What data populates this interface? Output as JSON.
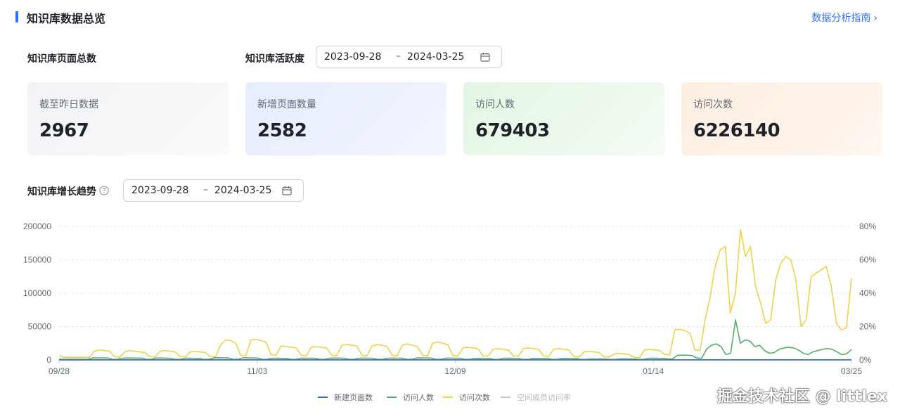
{
  "header": {
    "title": "知识库数据总览",
    "guide_link": "数据分析指南"
  },
  "overview": {
    "total_pages_label": "知识库页面总数",
    "activity_label": "知识库活跃度",
    "activity_range": {
      "start": "2023-09-28",
      "sep": "–",
      "end": "2024-03-25"
    }
  },
  "cards": [
    {
      "label": "截至昨日数据",
      "value": "2967"
    },
    {
      "label": "新增页面数量",
      "value": "2582"
    },
    {
      "label": "访问人数",
      "value": "679403"
    },
    {
      "label": "访问次数",
      "value": "6226140"
    }
  ],
  "trend": {
    "label": "知识库增长趋势",
    "range": {
      "start": "2023-09-28",
      "sep": "–",
      "end": "2024-03-25"
    }
  },
  "colors": {
    "accent": "#3370ff",
    "new_pages": "#3f6fd0",
    "visitors": "#5aaa6a",
    "visits": "#efd24a",
    "member_rate": "#c8cacd"
  },
  "watermark": "掘金技术社区 @ littlex",
  "chart_data": {
    "type": "line",
    "x_ticks": [
      "09/28",
      "11/03",
      "12/09",
      "01/14",
      "03/25"
    ],
    "y_left": {
      "ticks": [
        "0",
        "50000",
        "100000",
        "150000",
        "200000"
      ],
      "range": [
        0,
        200000
      ]
    },
    "y_right": {
      "ticks": [
        "0%",
        "20%",
        "40%",
        "60%",
        "80%"
      ],
      "range": [
        0,
        80
      ]
    },
    "grid": true,
    "legend_position": "bottom",
    "series": [
      {
        "name": "新建页面数",
        "axis": "left",
        "color": "#3f6fd0",
        "values": [
          200,
          150,
          150,
          150,
          150,
          150,
          180,
          200,
          200,
          200,
          200,
          220,
          200,
          200,
          180,
          200,
          200,
          220,
          200,
          180,
          200,
          180,
          200,
          200,
          200,
          180,
          200,
          200,
          200,
          200,
          180,
          200,
          220,
          200,
          200,
          200,
          200,
          200,
          200,
          200,
          200,
          200,
          200,
          200,
          200,
          200,
          200,
          200,
          200,
          200,
          200,
          200,
          200,
          200,
          200,
          200,
          200,
          200,
          200,
          200,
          200,
          200,
          200,
          200,
          200,
          200,
          200,
          200,
          200,
          200,
          200,
          200,
          200,
          200,
          200,
          200,
          200,
          200,
          200,
          200,
          200,
          200,
          200,
          200,
          200,
          200,
          200,
          200,
          200,
          200,
          200,
          200,
          200,
          200,
          200,
          200,
          200,
          200,
          200,
          200,
          200,
          200,
          200,
          200,
          200,
          200,
          200,
          200,
          200,
          200,
          200,
          200,
          200,
          200,
          200,
          200,
          200,
          200,
          200,
          200,
          200,
          200,
          200,
          200,
          200,
          200,
          200,
          200,
          200,
          200,
          200,
          200,
          200,
          200,
          200,
          200,
          200,
          200,
          200,
          200,
          200,
          200,
          200,
          200,
          200,
          200,
          200,
          200,
          200,
          200,
          200,
          200,
          200,
          200,
          200,
          200,
          200,
          200,
          200,
          200,
          200,
          200,
          200,
          200,
          200,
          200,
          200,
          200,
          200,
          200,
          200,
          200,
          200,
          200,
          200,
          200,
          200,
          200,
          200
        ]
      },
      {
        "name": "访问人数",
        "axis": "left",
        "color": "#5aaa6a",
        "values": [
          1200,
          1000,
          1000,
          1000,
          1000,
          1000,
          1200,
          3000,
          3200,
          3100,
          3000,
          1200,
          1000,
          2500,
          3000,
          2800,
          2700,
          2800,
          1200,
          1100,
          2800,
          2900,
          2700,
          2500,
          1100,
          1000,
          2500,
          2600,
          2400,
          2300,
          1000,
          1000,
          3000,
          3400,
          3200,
          3100,
          1200,
          1100,
          3200,
          3300,
          3000,
          2900,
          1100,
          1000,
          2600,
          2500,
          2400,
          2300,
          1000,
          1000,
          2500,
          2600,
          2500,
          2400,
          1000,
          1000,
          2700,
          2800,
          2700,
          2600,
          1100,
          1000,
          2600,
          2700,
          2600,
          2500,
          1000,
          1000,
          2600,
          2700,
          2600,
          2500,
          1000,
          1000,
          3000,
          3100,
          2900,
          2800,
          1100,
          1000,
          2600,
          2700,
          2600,
          2500,
          1000,
          1000,
          2300,
          2400,
          2300,
          2200,
          1000,
          1000,
          2400,
          2500,
          2400,
          2300,
          1000,
          1000,
          2300,
          2400,
          2300,
          2200,
          1000,
          1000,
          2300,
          2400,
          2300,
          2200,
          900,
          800,
          1500,
          1600,
          1500,
          1400,
          800,
          800,
          1600,
          1700,
          1600,
          1500,
          800,
          800,
          2400,
          2500,
          2400,
          2300,
          1500,
          1500,
          7000,
          7200,
          7000,
          6500,
          3000,
          2500,
          16000,
          22000,
          24000,
          20000,
          8000,
          10000,
          60000,
          25000,
          30000,
          28000,
          20000,
          22000,
          14000,
          10000,
          11000,
          16000,
          18000,
          19000,
          18000,
          15000,
          10000,
          8000,
          12000,
          14000,
          16000,
          17000,
          16000,
          12000,
          8000,
          9000,
          16000
        ]
      },
      {
        "name": "访问次数",
        "axis": "left",
        "color": "#efd24a",
        "values": [
          6000,
          4000,
          4000,
          4000,
          4000,
          4000,
          4000,
          13000,
          15000,
          14000,
          13000,
          5000,
          4000,
          12000,
          14000,
          13000,
          12000,
          11000,
          5000,
          4500,
          13000,
          14000,
          13000,
          12000,
          5000,
          4500,
          12000,
          13000,
          12000,
          11000,
          5000,
          4500,
          22000,
          30000,
          29000,
          25000,
          7000,
          6000,
          30000,
          31000,
          29000,
          27000,
          8000,
          7000,
          21000,
          20000,
          19000,
          18000,
          7000,
          6000,
          19000,
          20000,
          19000,
          18000,
          7000,
          6000,
          22000,
          23000,
          22000,
          21000,
          7000,
          6000,
          21000,
          23000,
          22000,
          20000,
          7000,
          6000,
          22000,
          24000,
          22000,
          20000,
          7000,
          6000,
          25000,
          27000,
          25000,
          23000,
          7000,
          6000,
          18000,
          19000,
          18000,
          17000,
          6000,
          5500,
          16000,
          17000,
          16000,
          15000,
          6000,
          5500,
          17000,
          18000,
          17000,
          16000,
          6000,
          5500,
          16000,
          17000,
          16000,
          15000,
          5000,
          4500,
          12000,
          13000,
          12000,
          11000,
          4500,
          4000,
          9000,
          10000,
          9000,
          8000,
          4000,
          3500,
          15000,
          16000,
          15000,
          14000,
          8000,
          8000,
          45000,
          46000,
          44000,
          40000,
          15000,
          14000,
          60000,
          95000,
          140000,
          165000,
          170000,
          70000,
          100000,
          195000,
          155000,
          170000,
          110000,
          85000,
          55000,
          60000,
          120000,
          145000,
          155000,
          150000,
          120000,
          50000,
          60000,
          125000,
          130000,
          135000,
          140000,
          110000,
          55000,
          45000,
          48000,
          122000
        ]
      },
      {
        "name": "空间成员访问率",
        "axis": "right",
        "color": "#c8cacd",
        "values": []
      }
    ]
  }
}
